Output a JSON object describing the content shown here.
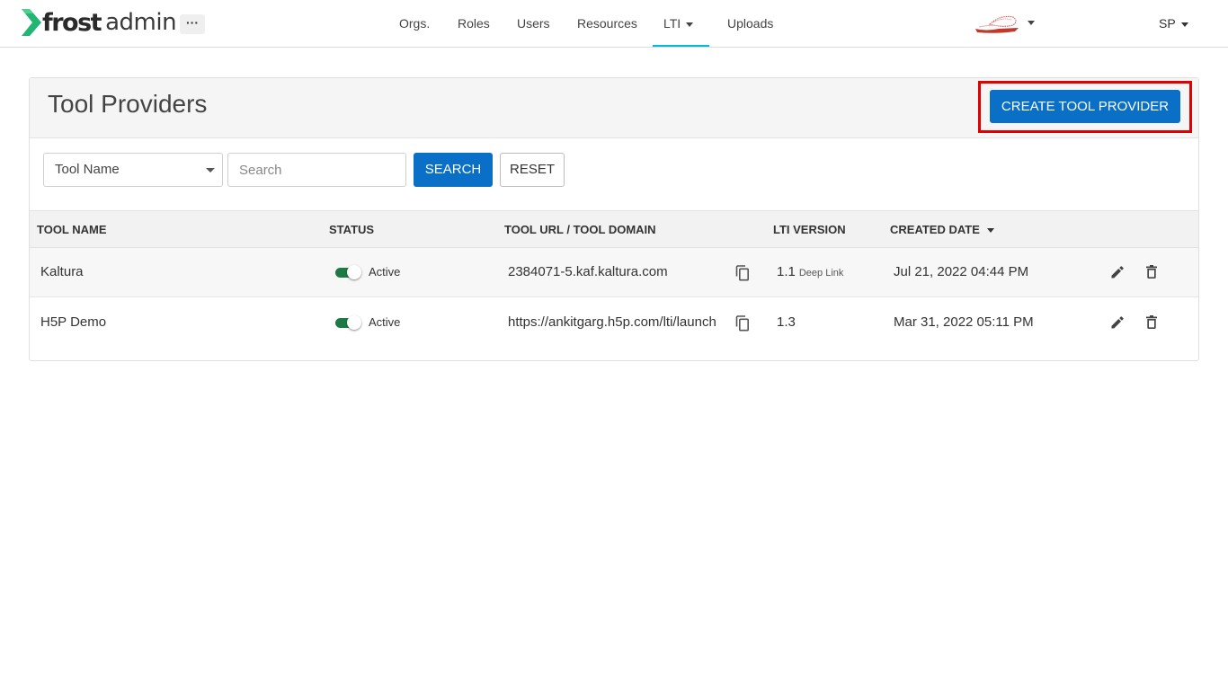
{
  "brand": {
    "logo_bold": "frost",
    "logo_light": "admin",
    "accent": "#00bcd4",
    "logo_mark_color": "#22b573"
  },
  "header": {
    "more_label": "···",
    "nav": [
      {
        "label": "Orgs."
      },
      {
        "label": "Roles"
      },
      {
        "label": "Users"
      },
      {
        "label": "Resources"
      },
      {
        "label": "LTI",
        "dropdown": true,
        "active": true
      },
      {
        "label": "Uploads"
      }
    ],
    "org_logo_icon": "org-logo",
    "user_initials": "SP"
  },
  "page": {
    "title": "Tool Providers",
    "create_button": "CREATE TOOL PROVIDER",
    "highlight_color": "#e00000"
  },
  "filters": {
    "field_select": "Tool Name",
    "search_placeholder": "Search",
    "search_button": "SEARCH",
    "reset_button": "RESET"
  },
  "table": {
    "columns": [
      "TOOL NAME",
      "STATUS",
      "TOOL URL / TOOL DOMAIN",
      "LTI VERSION",
      "CREATED DATE"
    ],
    "sort_column": "CREATED DATE",
    "rows": [
      {
        "name": "Kaltura",
        "status": "Active",
        "status_on": true,
        "url": "2384071-5.kaf.kaltura.com",
        "lti_version": "1.1",
        "lti_tag": "Deep Link",
        "created": "Jul 21, 2022 04:44 PM"
      },
      {
        "name": "H5P Demo",
        "status": "Active",
        "status_on": true,
        "url": "https://ankitgarg.h5p.com/lti/launch",
        "lti_version": "1.3",
        "lti_tag": "",
        "created": "Mar 31, 2022 05:11 PM"
      }
    ]
  },
  "colors": {
    "primary": "#0a6fc7",
    "toggle_on": "#1e7a45"
  }
}
